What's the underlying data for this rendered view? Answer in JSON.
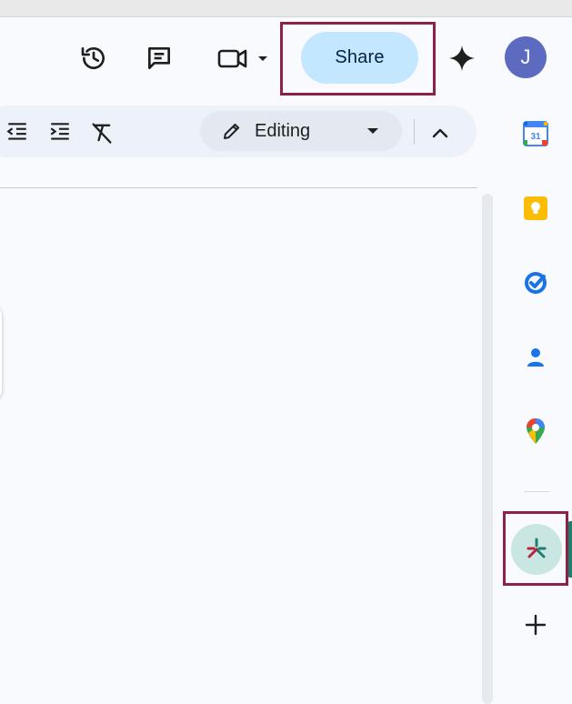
{
  "header": {
    "share_label": "Share",
    "avatar_initial": "J"
  },
  "toolbar": {
    "mode_label": "Editing"
  },
  "icons": {
    "version_history": "history-icon",
    "comments": "comment-icon",
    "meet": "video-camera-icon",
    "gemini": "sparkle-icon",
    "decrease_indent": "decrease-indent-icon",
    "increase_indent": "increase-indent-icon",
    "clear_formatting": "clear-formatting-icon",
    "editing_mode": "pencil-icon",
    "collapse": "chevron-up-icon"
  },
  "side_panel": {
    "apps": [
      "calendar-icon",
      "keep-icon",
      "tasks-icon",
      "contacts-icon",
      "maps-icon",
      "addon-icon"
    ],
    "add_icon": "plus-icon"
  },
  "colors": {
    "share_bg": "#c2e7ff",
    "highlight": "#8c2246",
    "avatar": "#5c6bc0",
    "addon_bg": "#c9e6e2"
  }
}
